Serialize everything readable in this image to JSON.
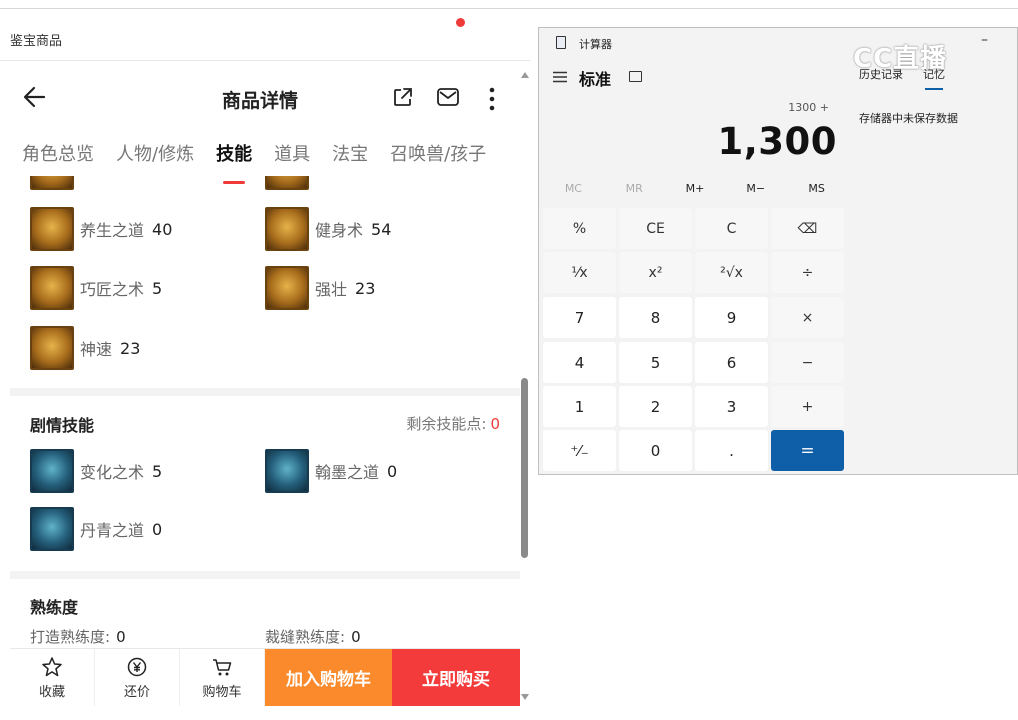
{
  "window": {
    "title": "鉴宝商品"
  },
  "header": {
    "title": "商品详情"
  },
  "tabs": [
    "角色总览",
    "人物/修炼",
    "技能",
    "道具",
    "法宝",
    "召唤兽/孩子"
  ],
  "skills_basic": [
    {
      "name": "养生之道",
      "value": "40"
    },
    {
      "name": "健身术",
      "value": "54"
    },
    {
      "name": "巧匠之术",
      "value": "5"
    },
    {
      "name": "强壮",
      "value": "23"
    },
    {
      "name": "神速",
      "value": "23"
    }
  ],
  "story_skills": {
    "title": "剧情技能",
    "remaining_label": "剩余技能点:",
    "remaining_value": "0",
    "items": [
      {
        "name": "变化之术",
        "value": "5"
      },
      {
        "name": "翰墨之道",
        "value": "0"
      },
      {
        "name": "丹青之道",
        "value": "0"
      }
    ]
  },
  "proficiency": {
    "title": "熟练度",
    "items": [
      {
        "name": "打造熟练度:",
        "value": "0"
      },
      {
        "name": "裁缝熟练度:",
        "value": "0"
      }
    ]
  },
  "bottom_bar": {
    "favorite": "收藏",
    "bargain": "还价",
    "cart": "购物车",
    "add_to_cart": "加入购物车",
    "buy_now": "立即购买"
  },
  "calculator": {
    "title": "计算器",
    "mode": "标准",
    "watermark": "CC直播",
    "expression": "1300 +",
    "display": "1,300",
    "memory_buttons": [
      "MC",
      "MR",
      "M+",
      "M−",
      "MS"
    ],
    "keys": [
      "%",
      "CE",
      "C",
      "⌫",
      "¹⁄x",
      "x²",
      "²√x",
      "÷",
      "7",
      "8",
      "9",
      "×",
      "4",
      "5",
      "6",
      "−",
      "1",
      "2",
      "3",
      "+",
      "⁺⁄₋",
      "0",
      ".",
      "="
    ],
    "panel_tabs": [
      "历史记录",
      "记忆"
    ],
    "memory_empty": "存储器中未保存数据"
  }
}
